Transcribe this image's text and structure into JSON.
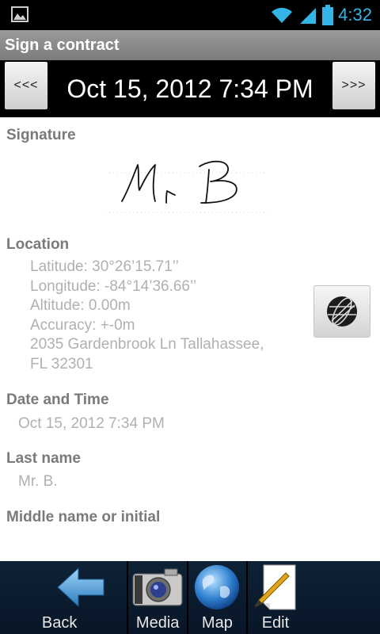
{
  "status_bar": {
    "time": "4:32",
    "icons": [
      "image-icon",
      "wifi-icon",
      "signal-icon",
      "battery-icon"
    ],
    "accent": "#33b5e5"
  },
  "title_bar": {
    "title": "Sign a contract"
  },
  "date_nav": {
    "prev_label": "<<<",
    "next_label": ">>>",
    "current": "Oct 15, 2012 7:34 PM"
  },
  "signature": {
    "label": "Signature",
    "signature_text": "Mr B"
  },
  "location": {
    "label": "Location",
    "lines": [
      "Latitude: 30°26’15.71’’",
      "Longitude: -84°14’36.66’’",
      "Altitude: 0.00m",
      "Accuracy: +-0m",
      "2035 Gardenbrook Ln Tallahassee,",
      "FL 32301"
    ],
    "map_button_icon": "globe-icon"
  },
  "date_time": {
    "label": "Date and Time",
    "value": "Oct 15, 2012 7:34 PM"
  },
  "last_name": {
    "label": "Last name",
    "value": "Mr. B."
  },
  "middle_name": {
    "label": "Middle name or initial"
  },
  "toolbar": {
    "items": [
      {
        "label": "Back",
        "icon": "back-arrow-icon"
      },
      {
        "label": "Media",
        "icon": "camera-icon"
      },
      {
        "label": "Map",
        "icon": "globe-icon"
      },
      {
        "label": "Edit",
        "icon": "pencil-paper-icon"
      }
    ]
  }
}
